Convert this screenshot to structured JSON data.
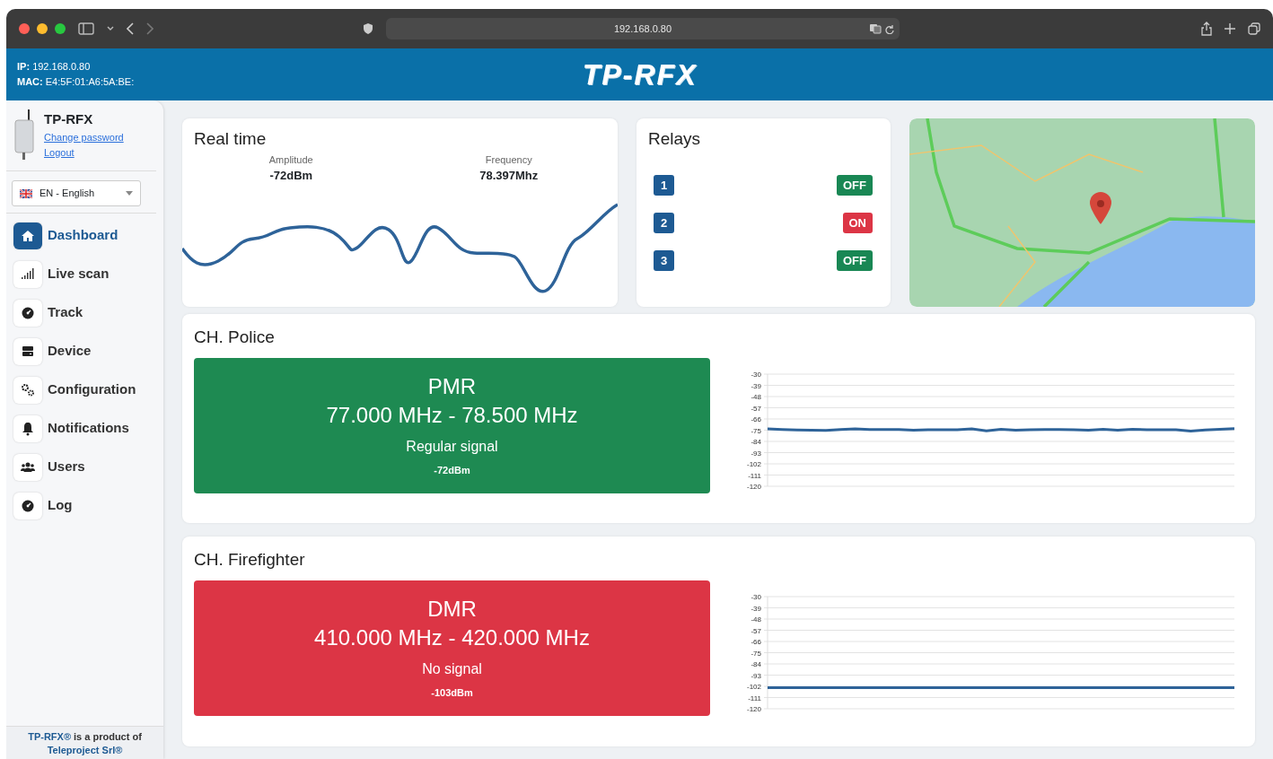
{
  "browser": {
    "url": "192.168.0.80"
  },
  "header": {
    "ip_label": "IP:",
    "ip": "192.168.0.80",
    "mac_label": "MAC:",
    "mac": "E4:5F:01:A6:5A:BE:",
    "logo": "TP-RFX"
  },
  "sidebar": {
    "device_name": "TP-RFX",
    "links": [
      "Change password",
      "Logout"
    ],
    "language": "EN - English",
    "items": [
      {
        "label": "Dashboard",
        "selected": true
      },
      {
        "label": "Live scan",
        "selected": false
      },
      {
        "label": "Track",
        "selected": false
      },
      {
        "label": "Device",
        "selected": false
      },
      {
        "label": "Configuration",
        "selected": false
      },
      {
        "label": "Notifications",
        "selected": false
      },
      {
        "label": "Users",
        "selected": false
      },
      {
        "label": "Log",
        "selected": false
      }
    ],
    "footer": {
      "brand": "TP-RFX®",
      "text": "is a product of",
      "company": "Teleproject Srl®"
    }
  },
  "realtime": {
    "title": "Real time",
    "amplitude_label": "Amplitude",
    "amplitude": "-72dBm",
    "frequency_label": "Frequency",
    "frequency": "78.397Mhz"
  },
  "relays": {
    "title": "Relays",
    "items": [
      {
        "number": "1",
        "state": "OFF",
        "on": false
      },
      {
        "number": "2",
        "state": "ON",
        "on": true
      },
      {
        "number": "3",
        "state": "OFF",
        "on": false
      }
    ]
  },
  "channels": [
    {
      "title": "CH. Police",
      "color": "#1e8a52",
      "mode": "PMR",
      "range": "77.000 MHz - 78.500 MHz",
      "signal": "Regular signal",
      "reading": "-72dBm",
      "chart_data": {
        "type": "line",
        "grid": true,
        "ylim": [
          -120,
          -30
        ],
        "yticks": [
          -30,
          -39,
          -48,
          -57,
          -66,
          -75,
          -84,
          -93,
          -102,
          -111,
          -120
        ],
        "series": [
          {
            "color": "#2e6399",
            "values": [
              -74,
              -74.5,
              -74.8,
              -75,
              -75.2,
              -74.5,
              -74,
              -74.4,
              -74.5,
              -74.5,
              -75,
              -74.7,
              -74.6,
              -74.6,
              -74,
              -75.5,
              -74.2,
              -75,
              -74.7,
              -74.5,
              -74.4,
              -74.6,
              -74.9,
              -74.3,
              -75,
              -74.2,
              -74.6,
              -74.7,
              -74.7,
              -75.8,
              -74.8,
              -74.3,
              -73.8
            ]
          }
        ]
      }
    },
    {
      "title": "CH. Firefighter",
      "color": "#dc3545",
      "mode": "DMR",
      "range": "410.000 MHz - 420.000 MHz",
      "signal": "No signal",
      "reading": "-103dBm",
      "chart_data": {
        "type": "line",
        "grid": true,
        "ylim": [
          -120,
          -30
        ],
        "yticks": [
          -30,
          -39,
          -48,
          -57,
          -66,
          -75,
          -84,
          -93,
          -102,
          -111,
          -120
        ],
        "series": [
          {
            "color": "#2e6399",
            "values": [
              -103,
              -103,
              -103,
              -103,
              -103,
              -103,
              -103,
              -103,
              -103,
              -103,
              -103,
              -103,
              -103,
              -103,
              -103,
              -103,
              -103,
              -103,
              -103,
              -103
            ]
          }
        ]
      }
    }
  ]
}
